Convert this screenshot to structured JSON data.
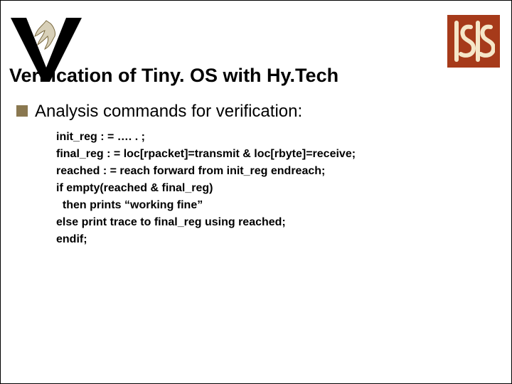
{
  "title": "Verification of Tiny. OS with Hy.Tech",
  "bullet": "Analysis commands for verification:",
  "code": {
    "l1": "init_reg : = …. . ;",
    "l2": "final_reg : = loc[rpacket]=transmit & loc[rbyte]=receive;",
    "l3": "reached : = reach forward from init_reg endreach;",
    "l4": "if empty(reached & final_reg)",
    "l5": "  then prints “working fine”",
    "l6": "else print trace to final_reg using reached;",
    "l7": "endif;"
  },
  "logos": {
    "left": "v-oakleaf-logo",
    "right": "isis-logo"
  },
  "colors": {
    "bullet": "#8a7850",
    "isis_bg": "#a63a1a"
  }
}
